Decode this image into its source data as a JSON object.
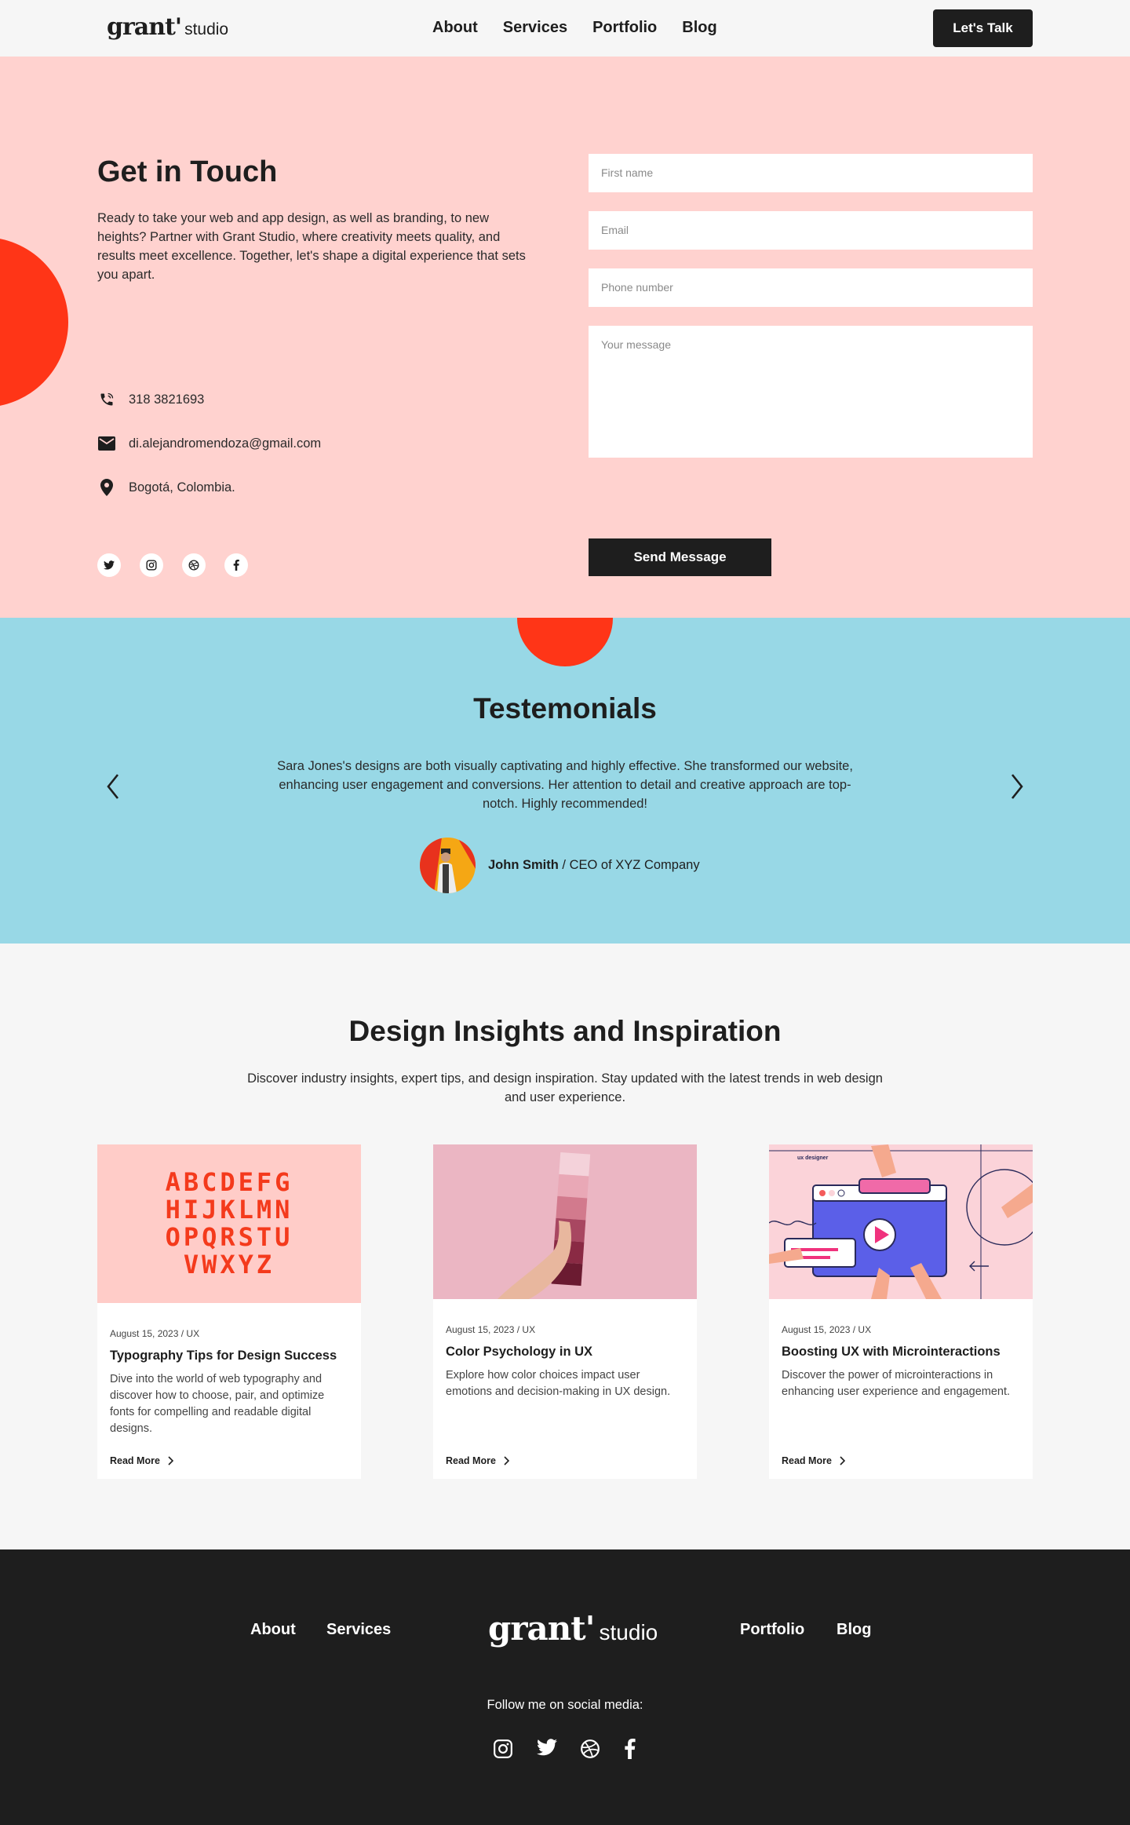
{
  "nav": {
    "logo_main": "grant'",
    "logo_sub": "studio",
    "links": [
      "About",
      "Services",
      "Portfolio",
      "Blog"
    ],
    "cta": "Let's Talk"
  },
  "contact": {
    "title": "Get in Touch",
    "intro": "Ready to take your web and app design, as well as branding, to new heights? Partner with Grant Studio, where creativity meets quality, and results meet excellence. Together, let's shape a digital experience that sets you apart.",
    "phone": "318 3821693",
    "email": "di.alejandromendoza@gmail.com",
    "location": "Bogotá, Colombia.",
    "socials": [
      "twitter-icon",
      "instagram-icon",
      "dribbble-icon",
      "facebook-icon"
    ],
    "form": {
      "first_name_placeholder": "First name",
      "email_placeholder": "Email",
      "phone_placeholder": "Phone number",
      "message_placeholder": "Your message",
      "submit": "Send Message"
    }
  },
  "testimonials": {
    "title": "Testemonials",
    "quote": "Sara Jones's designs are both visually captivating and highly effective. She transformed our website, enhancing user engagement and conversions. Her attention to detail and creative approach are top-notch. Highly recommended!",
    "author_name": "John Smith",
    "author_role": " / CEO of XYZ Company"
  },
  "blog": {
    "title": "Design Insights and Inspiration",
    "subtitle": "Discover industry insights, expert tips, and design inspiration. Stay updated with the latest trends in web design and user experience.",
    "read_more": "Read More",
    "cards": [
      {
        "meta": "August 15, 2023 / UX",
        "title": "Typography Tips for Design Success",
        "text": "Dive into the world of web typography and discover how to choose, pair, and optimize fonts for compelling and readable digital designs.",
        "image_text": "ABCDEFG HIJKLMN OPQRSTU VWXYZ"
      },
      {
        "meta": "August 15, 2023 / UX",
        "title": "Color Psychology in UX",
        "text": "Explore how color choices impact user emotions and decision-making in UX design."
      },
      {
        "meta": "August 15, 2023 / UX",
        "title": "Boosting UX with Microinteractions",
        "text": "Discover the power of microinteractions in enhancing user experience and engagement.",
        "image_text": "ux designer"
      }
    ]
  },
  "footer": {
    "links_left": [
      "About",
      "Services"
    ],
    "links_right": [
      "Portfolio",
      "Blog"
    ],
    "logo_main": "grant'",
    "logo_sub": "studio",
    "follow": "Follow me on social media:",
    "socials": [
      "instagram-icon",
      "twitter-icon",
      "dribbble-icon",
      "facebook-icon"
    ]
  },
  "colors": {
    "accent": "#ff3517",
    "contact_bg": "#ffd2cf",
    "testimonials_bg": "#98d8e6",
    "dark": "#1e1e1e"
  }
}
